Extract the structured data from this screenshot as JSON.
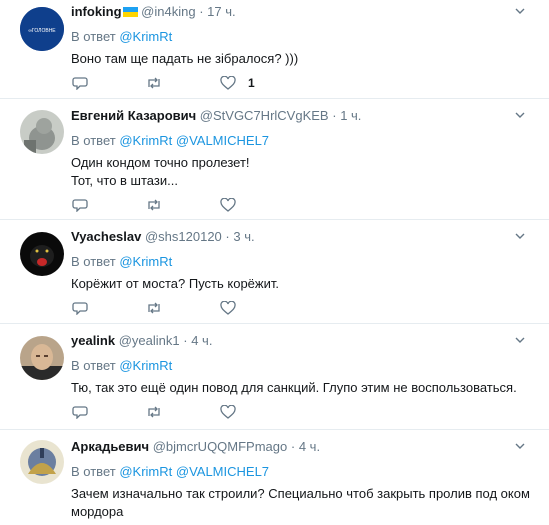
{
  "reply_prefix": "В ответ",
  "tweets": [
    {
      "name": "infoking",
      "handle": "@in4king",
      "time": "17 ч.",
      "mentions": [
        "@KrimRt"
      ],
      "text": [
        "Воно там ще падать не зібралося? )))"
      ],
      "like_count": "1",
      "avatar_label": "∞ГОЛОВНЕ"
    },
    {
      "name": "Евгений Казарович",
      "handle": "@StVGC7HrlCVgKEB",
      "time": "1 ч.",
      "mentions": [
        "@KrimRt",
        "@VALMICHEL7"
      ],
      "text": [
        "Один кондом точно пролезет!",
        "Тот, что в штази..."
      ],
      "like_count": ""
    },
    {
      "name": "Vyacheslav",
      "handle": "@shs120120",
      "time": "3 ч.",
      "mentions": [
        "@KrimRt"
      ],
      "text": [
        "Корёжит от моста? Пусть корёжит."
      ],
      "like_count": ""
    },
    {
      "name": "yealink",
      "handle": "@yealink1",
      "time": "4 ч.",
      "mentions": [
        "@KrimRt"
      ],
      "text": [
        "Тю, так это ещё один повод для санкций. Глупо этим не воспользоваться."
      ],
      "like_count": ""
    },
    {
      "name": "Аркадьевич",
      "handle": "@bjmcrUQQMFPmago",
      "time": "4 ч.",
      "mentions": [
        "@KrimRt",
        "@VALMICHEL7"
      ],
      "text": [
        "Зачем изначально так строили? Специально чтоб закрыть пролив под оком",
        "мордора"
      ],
      "like_count": ""
    }
  ],
  "colors": {
    "link": "#1b95e0",
    "secondary": "#657786",
    "text": "#14171a",
    "divider": "#e6ecf0",
    "flag_blue": "#1da1f2",
    "flag_yellow": "#ffd500"
  }
}
